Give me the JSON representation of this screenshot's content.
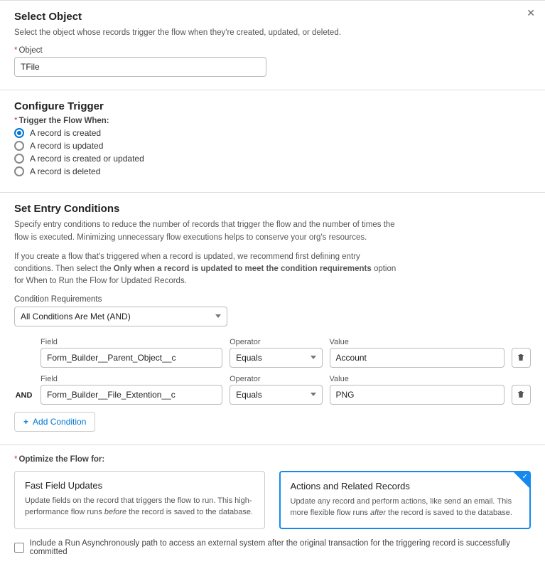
{
  "select_object": {
    "title": "Select Object",
    "desc": "Select the object whose records trigger the flow when they're created, updated, or deleted.",
    "object_label": "Object",
    "object_value": "TFile"
  },
  "configure_trigger": {
    "title": "Configure Trigger",
    "label": "Trigger the Flow When:",
    "options": {
      "created": "A record is created",
      "updated": "A record is updated",
      "created_updated": "A record is created or updated",
      "deleted": "A record is deleted"
    }
  },
  "entry": {
    "title": "Set Entry Conditions",
    "p1": "Specify entry conditions to reduce the number of records that trigger the flow and the number of times the flow is executed. Minimizing unnecessary flow executions helps to conserve your org's resources.",
    "p2a": "If you create a flow that's triggered when a record is updated, we recommend first defining entry conditions. Then select the ",
    "p2b": "Only when a record is updated to meet the condition requirements",
    "p2c": " option for When to Run the Flow for Updated Records.",
    "cond_req_label": "Condition Requirements",
    "cond_req_value": "All Conditions Are Met (AND)",
    "labels": {
      "field": "Field",
      "operator": "Operator",
      "value": "Value",
      "and": "AND"
    },
    "rows": [
      {
        "field": "Form_Builder__Parent_Object__c",
        "operator": "Equals",
        "value": "Account"
      },
      {
        "field": "Form_Builder__File_Extention__c",
        "operator": "Equals",
        "value": "PNG"
      }
    ],
    "add": "Add Condition"
  },
  "optimize": {
    "label": "Optimize the Flow for:",
    "fast": {
      "title": "Fast Field Updates",
      "d1": "Update fields on the record that triggers the flow to run. This high-performance flow runs ",
      "d2": "before",
      "d3": " the record is saved to the database."
    },
    "actions": {
      "title": "Actions and Related Records",
      "d1": "Update any record and perform actions, like send an email. This more flexible flow runs ",
      "d2": "after",
      "d3": " the record is saved to the database."
    },
    "async": "Include a Run Asynchronously path to access an external system after the original transaction for the triggering record is successfully committed"
  }
}
